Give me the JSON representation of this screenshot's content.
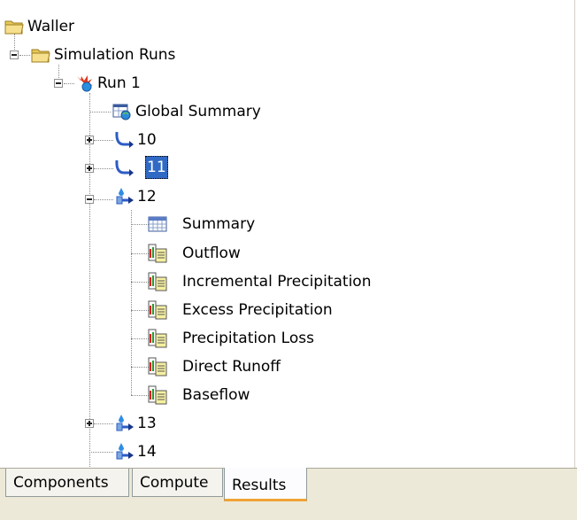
{
  "tree": {
    "root": {
      "label": "Waller",
      "icon": "folder-open-icon"
    },
    "simulation_runs": {
      "label": "Simulation Runs",
      "icon": "folder-open-icon"
    },
    "run": {
      "label": "Run 1",
      "icon": "run-icon"
    },
    "global_summary": {
      "label": "Global Summary",
      "icon": "global-summary-icon"
    },
    "nodes": [
      {
        "label": "10",
        "icon": "reach-icon",
        "expanded": false
      },
      {
        "label": "11",
        "icon": "reach-icon",
        "expanded": false,
        "selected": true
      },
      {
        "label": "12",
        "icon": "subbasin-icon",
        "expanded": true
      },
      {
        "label": "13",
        "icon": "subbasin-icon",
        "expanded": false
      },
      {
        "label": "14",
        "icon": "subbasin-icon",
        "expanded": false
      }
    ],
    "children_of_12": [
      {
        "label": "Summary",
        "icon": "summary-table-icon"
      },
      {
        "label": "Outflow",
        "icon": "graph-table-icon"
      },
      {
        "label": "Incremental Precipitation",
        "icon": "graph-table-icon"
      },
      {
        "label": "Excess Precipitation",
        "icon": "graph-table-icon"
      },
      {
        "label": "Precipitation Loss",
        "icon": "graph-table-icon"
      },
      {
        "label": "Direct Runoff",
        "icon": "graph-table-icon"
      },
      {
        "label": "Baseflow",
        "icon": "graph-table-icon"
      }
    ]
  },
  "tabs": [
    {
      "label": "Components",
      "active": false
    },
    {
      "label": "Compute",
      "active": false
    },
    {
      "label": "Results",
      "active": true
    }
  ],
  "colors": {
    "selection": "#316ac5",
    "active_tab_accent": "#f1a336",
    "tab_bar_background": "#ece9d8"
  }
}
